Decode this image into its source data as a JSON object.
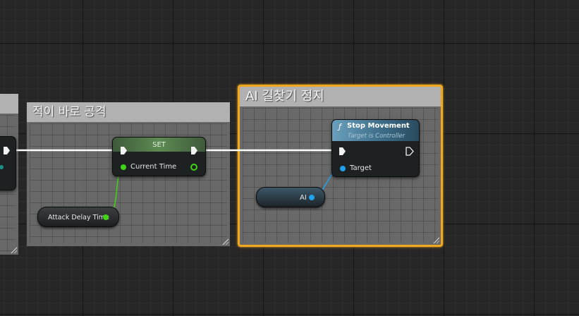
{
  "colors": {
    "float_pin": "#3fd414",
    "object_pin": "#1fa0ea",
    "exec_wire": "#ffffff",
    "highlight": "#f0a81e"
  },
  "comments": {
    "left_partial": "",
    "attack": "적이 바로 공격",
    "ai_stop": "AI 길찾기 정지"
  },
  "set_node": {
    "title": "SET",
    "pin_label": "Current Time"
  },
  "attack_delay_node": {
    "label": "Attack Delay Time"
  },
  "ai_node": {
    "label": "AI"
  },
  "stop_movement_node": {
    "icon": "function-icon",
    "icon_glyph": "ƒ",
    "title": "Stop Movement",
    "subtitle": "Target is Controller",
    "pin_label": "Target"
  }
}
